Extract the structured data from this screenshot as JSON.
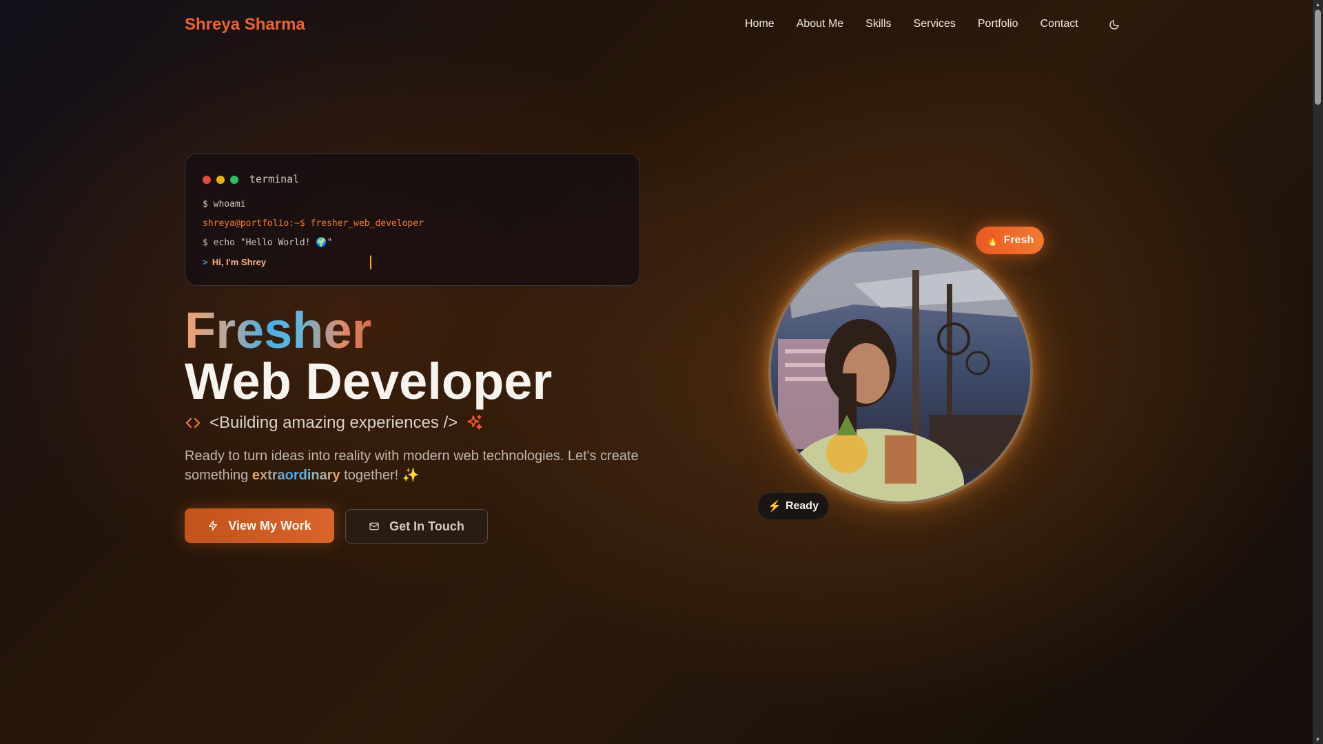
{
  "nav": {
    "brand": "Shreya Sharma",
    "links": [
      "Home",
      "About Me",
      "Skills",
      "Services",
      "Portfolio",
      "Contact"
    ],
    "theme_icon": "moon-icon"
  },
  "terminal": {
    "title": "terminal",
    "dot_colors": [
      "#ef4444",
      "#eab308",
      "#22c55e"
    ],
    "line1": "$ whoami",
    "line2": "shreya@portfolio:~$ fresher_web_developer",
    "line3": "$ echo \"Hello World! 🌍\"",
    "prompt": ">",
    "typed": "Hi, I'm Shrey"
  },
  "hero": {
    "heading_1": "Fresher",
    "heading_2": "Web Developer",
    "tagline": "<Building amazing experiences />",
    "tagline_icons": [
      "code-icon",
      "sparkles-icon"
    ],
    "desc_before": "Ready to turn ideas into reality with modern web technologies. Let's create something ",
    "desc_highlight": "extraordinary",
    "desc_after": " together! ✨"
  },
  "buttons": {
    "primary": "View My Work",
    "primary_icon": "lightning-icon",
    "secondary": "Get In Touch",
    "secondary_icon": "mail-icon"
  },
  "profile": {
    "badge_fresh": "Fresh",
    "badge_fresh_emoji": "🔥",
    "badge_ready": "Ready",
    "badge_ready_emoji": "⚡"
  },
  "colors": {
    "accent": "#f2622a",
    "link_blue": "#3fa9f5"
  }
}
